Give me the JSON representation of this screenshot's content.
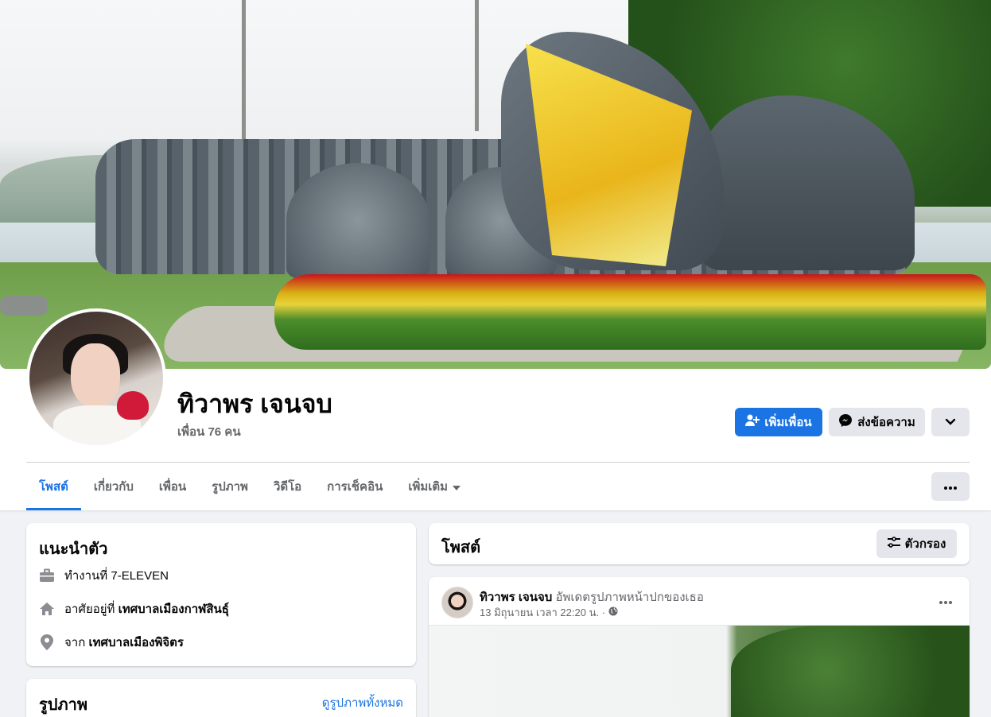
{
  "profile": {
    "name": "ทิวาพร เจนจบ",
    "friends_count": "เพื่อน 76 คน"
  },
  "actions": {
    "add_friend": "เพิ่มเพื่อน",
    "message": "ส่งข้อความ"
  },
  "tabs": [
    {
      "label": "โพสต์",
      "active": true
    },
    {
      "label": "เกี่ยวกับ"
    },
    {
      "label": "เพื่อน"
    },
    {
      "label": "รูปภาพ"
    },
    {
      "label": "วิดีโอ"
    },
    {
      "label": "การเช็คอิน"
    },
    {
      "label": "เพิ่มเติม"
    }
  ],
  "intro": {
    "title": "แนะนำตัว",
    "work_prefix": "ทำงานที่ ",
    "work": "7-ELEVEN",
    "lives_prefix": "อาศัยอยู่ที่ ",
    "lives": "เทศบาลเมืองกาฬสินธุ์",
    "from_prefix": "จาก ",
    "from": "เทศบาลเมืองพิจิตร"
  },
  "photos": {
    "title": "รูปภาพ",
    "see_all": "ดูรูปภาพทั้งหมด"
  },
  "posts": {
    "title": "โพสต์",
    "filter": "ตัวกรอง"
  },
  "post": {
    "author": "ทิวาพร เจนจบ",
    "action": " อัพเดตรูปภาพหน้าปกของเธอ",
    "time": "13 มิถุนายน เวลา 22:20 น. ·"
  },
  "colors": {
    "accent": "#1b74e4",
    "background": "#f0f2f5",
    "button_gray": "#e4e6eb",
    "muted_text": "#65676b"
  }
}
